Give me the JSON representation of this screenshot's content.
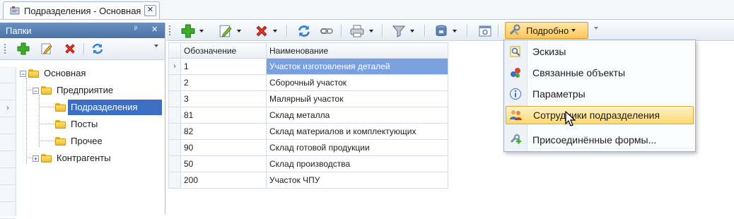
{
  "document_tab": {
    "title": "Подразделения - Основная",
    "close": "✕"
  },
  "left_panel": {
    "title": "Папки",
    "pin": "ᵖ",
    "close": "✕",
    "tree": [
      {
        "label": "Основная",
        "level": 0,
        "expander": "−"
      },
      {
        "label": "Предприятие",
        "level": 1,
        "expander": "−"
      },
      {
        "label": "Подразделения",
        "level": 2,
        "selected": true
      },
      {
        "label": "Посты",
        "level": 2
      },
      {
        "label": "Прочее",
        "level": 2
      },
      {
        "label": "Контрагенты",
        "level": 1,
        "expander": "+"
      }
    ]
  },
  "toolbar": {
    "details_label": "Подробно"
  },
  "grid": {
    "columns": [
      "Обозначение",
      "Наименование"
    ],
    "rows": [
      {
        "code": "1",
        "name": "Участок изготовления деталей",
        "current": true
      },
      {
        "code": "2",
        "name": "Сборочный участок"
      },
      {
        "code": "3",
        "name": "Малярный участок"
      },
      {
        "code": "81",
        "name": "Склад металла"
      },
      {
        "code": "82",
        "name": "Склад материалов и комплектующих"
      },
      {
        "code": "90",
        "name": "Склад готовой продукции"
      },
      {
        "code": "50",
        "name": "Склад производства"
      },
      {
        "code": "200",
        "name": "Участок ЧПУ"
      }
    ]
  },
  "menu": {
    "items": [
      {
        "label": "Эскизы",
        "icon": "sketch-icon"
      },
      {
        "label": "Связанные объекты",
        "icon": "linked-objects-icon"
      },
      {
        "label": "Параметры",
        "icon": "info-icon"
      },
      {
        "label": "Сотрудники подразделения",
        "icon": "employees-icon",
        "hover": true
      },
      {
        "label": "Присоединённые формы...",
        "icon": "attached-forms-icon"
      }
    ]
  },
  "colors": {
    "accent": "#3c6fc2",
    "header": "#5a80b5",
    "highlight": "#fbc65a"
  }
}
